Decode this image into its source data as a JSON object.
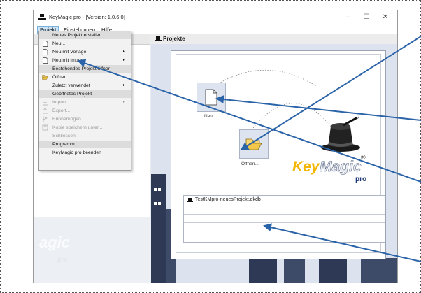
{
  "window": {
    "title": "KeyMagic pro - [Version: 1.0.6.0]",
    "minimize": "–",
    "maximize": "☐",
    "close": "✕"
  },
  "menubar": {
    "items": [
      "Projekt",
      "Einstellungen",
      "Hilfe"
    ]
  },
  "dropdown": {
    "items": [
      {
        "label": "Neues Projekt erstellen",
        "type": "header"
      },
      {
        "label": "Neu...",
        "icon": "new-document-icon",
        "type": "item"
      },
      {
        "label": "Neu mit Vorlage",
        "icon": "new-document-icon",
        "type": "item",
        "submenu": "▸"
      },
      {
        "label": "Neu mit Import",
        "icon": "new-document-icon",
        "type": "item",
        "submenu": "▸"
      },
      {
        "label": "Bestehendes Projekt öffnen",
        "type": "header"
      },
      {
        "label": "Öffnen...",
        "icon": "open-folder-icon",
        "type": "item"
      },
      {
        "label": "Zuletzt verwendet",
        "type": "item",
        "submenu": "▸"
      },
      {
        "label": "Geöffnetes Projekt",
        "type": "header"
      },
      {
        "label": "Import",
        "icon": "import-icon",
        "type": "disabled",
        "submenu": "▸"
      },
      {
        "label": "Export...",
        "icon": "export-icon",
        "type": "disabled"
      },
      {
        "label": "Erinnerungen...",
        "icon": "reminder-icon",
        "type": "disabled"
      },
      {
        "label": "Kopie speichern unter...",
        "icon": "save-icon",
        "type": "disabled"
      },
      {
        "label": "Schliessen",
        "type": "disabled"
      },
      {
        "label": "Programm",
        "type": "header"
      },
      {
        "label": "KeyMagic pro beenden",
        "type": "item"
      }
    ]
  },
  "main": {
    "header": "Projekte",
    "new_label": "Neu...",
    "open_label": "Öffnen...",
    "recent_files": [
      "TestKMpro-neuesProjekt.dkdb",
      "",
      "",
      ""
    ]
  },
  "logo": {
    "key": "Key",
    "magic": "Magic",
    "registered": "®",
    "pro": "pro",
    "left_faded": "agic",
    "left_faded_pro": "pro"
  },
  "colors": {
    "accent_arrow": "#2a63a8",
    "logo_yellow": "#f2b705",
    "menu_highlight": "#cce4f7"
  }
}
